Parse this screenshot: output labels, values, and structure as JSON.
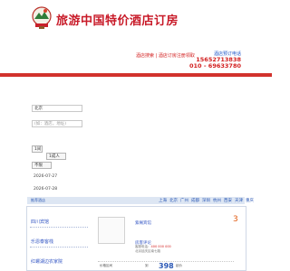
{
  "header": {
    "title": "旅游中国特价酒店订房",
    "center_link": "酒店搜索 | 酒店订房注册领取",
    "contact_prefix": "酒店预订电话",
    "phone1": "15652713838",
    "phone2": "010 - 69633780"
  },
  "search": {
    "city_value": "北京",
    "keyword_placeholder": "(如：酒店，地址)",
    "rooms_value": "1间",
    "adults_value": "1成人",
    "type_value": "不限",
    "checkin": "2026-07-27",
    "checkout": "2026-07-28"
  },
  "nav": {
    "hotels_label": "推荐酒店",
    "cities": [
      "上海",
      "北京",
      "广州",
      "成都",
      "深圳",
      "杭州",
      "西安",
      "天津",
      "重庆"
    ]
  },
  "left_links": [
    "四川宾馆",
    "乐恩泰客栈 ",
    "红螺湖边农家院"
  ],
  "hotel": {
    "name": "紫阁宾馆",
    "rooms_link": "房客评论",
    "tel_label": "客服电话：",
    "tel_value": "400 000 000",
    "address": "北京延庆区南七路 ",
    "rating": "3",
    "price_label1": "价格区间",
    "price_label2": "到",
    "price": "398",
    "price_label3": "起价"
  },
  "colors": {
    "brand_red": "#c81a28",
    "link_blue": "#2b58b5",
    "bar_red": "#d2322d"
  }
}
